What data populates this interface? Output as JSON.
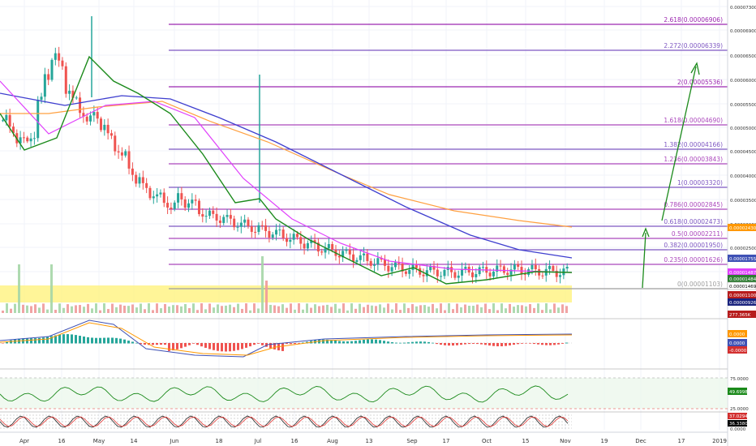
{
  "chart_data": {
    "type": "line",
    "title": "",
    "xlabel": "",
    "ylabel": "",
    "x_ticks": [
      "Apr",
      "16",
      "May",
      "14",
      "Jun",
      "18",
      "Jul",
      "16",
      "Aug",
      "13",
      "Sep",
      "17",
      "Oct",
      "15",
      "Nov",
      "19",
      "Dec",
      "17",
      "2019"
    ],
    "price_axis_ticks": [
      "0.00007300",
      "0.00006900",
      "0.00006500",
      "0.00006000",
      "0.00005500",
      "0.00005000",
      "0.00004500",
      "0.00004000",
      "0.00003500",
      "0.00003000",
      "0.00002500",
      "0.00002000"
    ],
    "ylim": [
      9.5e-06,
      7.3e-06
    ],
    "fib_levels": [
      {
        "label": "2.618(0.00006906)",
        "value": 6.906e-05,
        "color": "#9c27b0"
      },
      {
        "label": "2.272(0.00006339)",
        "value": 6.339e-05,
        "color": "#7e57c2"
      },
      {
        "label": "2(0.00005536)",
        "value": 5.536e-05,
        "color": "#9c27b0"
      },
      {
        "label": "1.618(0.00004690)",
        "value": 4.69e-05,
        "color": "#ab47bc"
      },
      {
        "label": "1.382(0.00004166)",
        "value": 4.166e-05,
        "color": "#7e57c2"
      },
      {
        "label": "1.236(0.00003843)",
        "value": 3.843e-05,
        "color": "#ab47bc"
      },
      {
        "label": "1(0.00003320)",
        "value": 3.32e-05,
        "color": "#7e57c2"
      },
      {
        "label": "0.786(0.00002845)",
        "value": 2.845e-05,
        "color": "#ab47bc"
      },
      {
        "label": "0.618(0.00002473)",
        "value": 2.473e-05,
        "color": "#7e57c2"
      },
      {
        "label": "0.5(0.00002211)",
        "value": 2.211e-05,
        "color": "#ab47bc"
      },
      {
        "label": "0.382(0.00001950)",
        "value": 1.95e-05,
        "color": "#7e57c2"
      },
      {
        "label": "0.235(0.00001626)",
        "value": 1.626e-05,
        "color": "#ab47bc"
      },
      {
        "label": "0(0.00001103)",
        "value": 1.103e-05,
        "color": "#9e9e9e"
      }
    ],
    "price_badges": [
      {
        "text": "0.00002430",
        "bg": "#ff9800"
      },
      {
        "text": "0.00001755",
        "bg": "#3f51b5"
      },
      {
        "text": "0.00001487",
        "bg": "#e040fb"
      },
      {
        "text": "0.00001484",
        "bg": "#2e7d32"
      },
      {
        "text": "0.00001469",
        "bg": "#ffffff"
      },
      {
        "text": "0.00001100",
        "bg": "#b71c1c"
      },
      {
        "text": "0.00000926",
        "bg": "#1a237e"
      }
    ],
    "volume_badge": "277.365K",
    "macd_badges": [
      {
        "text": "0.0000",
        "bg": "#ff9800"
      },
      {
        "text": "0.0000",
        "bg": "#3f51b5"
      },
      {
        "text": "-0.0000",
        "bg": "#d32f2f"
      }
    ],
    "rsi_axis": [
      "75.0000",
      "25.0000"
    ],
    "rsi_value": "49.6998",
    "stoch_values": [
      "37.0294",
      "36.3380"
    ],
    "stoch_axis_bottom": "0.0000",
    "close_series": [
      48,
      46,
      44,
      43,
      45,
      52,
      58,
      62,
      60,
      55,
      52,
      50,
      48,
      49,
      47,
      44,
      42,
      40,
      37,
      35,
      33,
      32,
      31,
      30,
      29,
      31,
      30,
      29.5,
      28,
      27,
      26.8,
      26.5,
      26,
      25.5,
      25,
      24.6,
      24.2,
      23.8,
      23.4,
      23,
      22.5,
      22,
      21.5,
      21,
      20.5,
      20,
      19.6,
      19.2,
      18.8,
      18.4,
      18,
      17.6,
      17.2,
      16.8,
      16.4,
      16,
      15.7,
      15.4,
      15.1,
      14.9,
      14.8,
      14.8,
      14.7,
      14.6,
      14.5,
      14.6,
      14.7,
      14.7,
      14.8,
      14.9,
      15,
      15.1,
      15.2,
      15.2,
      15.1,
      15,
      14.9,
      14.8,
      14.8,
      14.7,
      14.7
    ],
    "colors": {
      "up": "#26a69a",
      "down": "#ef5350",
      "ma_fast": "#1b8a1b",
      "ma_mid": "#e040fb",
      "ma_slow": "#3f3fcf",
      "ma_long": "#ffa040",
      "support_zone": "#fff176",
      "arrow": "#1b8a1b"
    }
  }
}
